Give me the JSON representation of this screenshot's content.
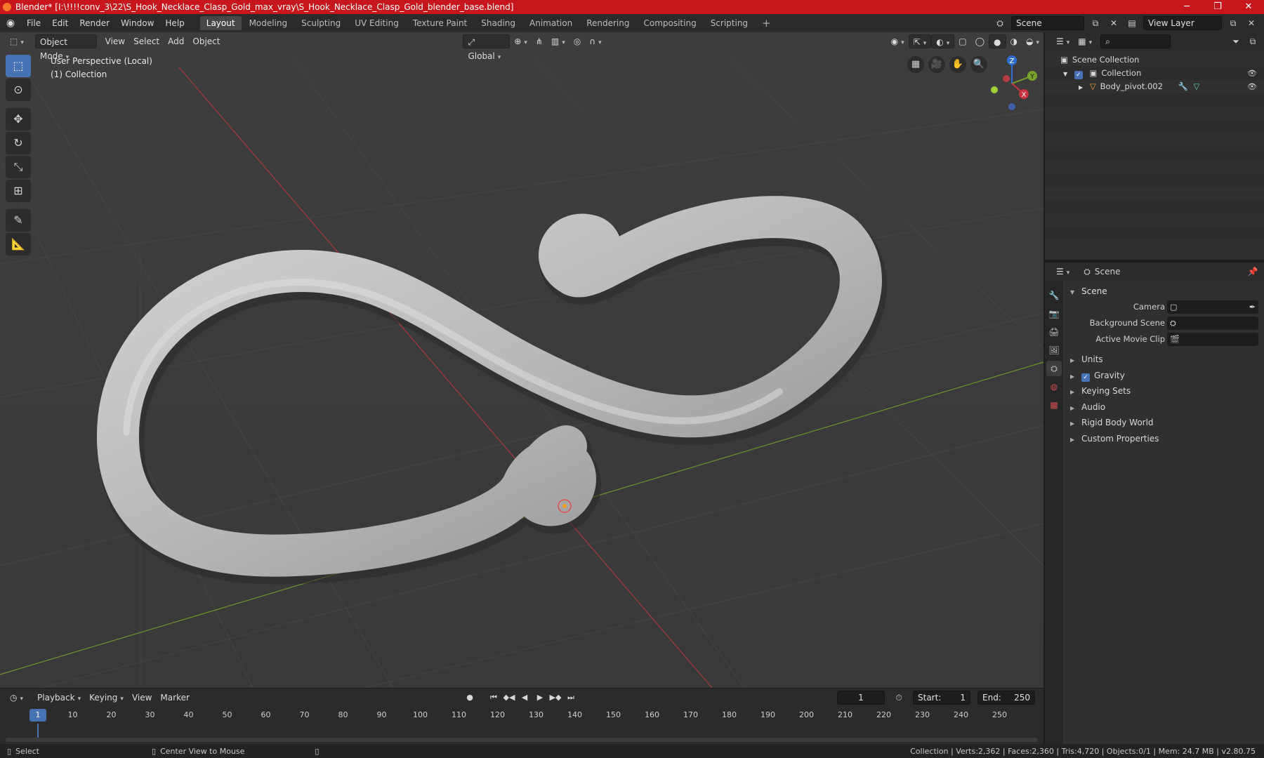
{
  "title_bar": {
    "title": "Blender* [I:\\!!!!conv_3\\22\\S_Hook_Necklace_Clasp_Gold_max_vray\\S_Hook_Necklace_Clasp_Gold_blender_base.blend]",
    "minimize": "─",
    "maximize": "❐",
    "close": "✕"
  },
  "menu": [
    "File",
    "Edit",
    "Render",
    "Window",
    "Help"
  ],
  "workspaces": [
    {
      "label": "Layout",
      "active": true
    },
    {
      "label": "Modeling"
    },
    {
      "label": "Sculpting"
    },
    {
      "label": "UV Editing"
    },
    {
      "label": "Texture Paint"
    },
    {
      "label": "Shading"
    },
    {
      "label": "Animation"
    },
    {
      "label": "Rendering"
    },
    {
      "label": "Compositing"
    },
    {
      "label": "Scripting"
    }
  ],
  "scene_selector": "Scene",
  "view_layer": "View Layer",
  "viewport": {
    "mode": "Object Mode",
    "menus": [
      "View",
      "Select",
      "Add",
      "Object"
    ],
    "transform_orientation": "Global",
    "info_line1": "User Perspective (Local)",
    "info_line2": "(1) Collection",
    "gizmo": {
      "x": "X",
      "y": "Y",
      "z": "Z"
    },
    "colors": {
      "x_axis": "#c9333d",
      "y_axis": "#7aa32b",
      "z_axis": "#2f6dd1",
      "object": "#bebebe"
    }
  },
  "timeline": {
    "menus": [
      "Playback",
      "Keying",
      "View",
      "Marker"
    ],
    "current_frame": "1",
    "start_label": "Start:",
    "start": "1",
    "end_label": "End:",
    "end": "250",
    "ticks": [
      "10",
      "20",
      "30",
      "40",
      "50",
      "60",
      "70",
      "80",
      "90",
      "100",
      "110",
      "120",
      "130",
      "140",
      "150",
      "160",
      "170",
      "180",
      "190",
      "200",
      "210",
      "220",
      "230",
      "240",
      "250"
    ]
  },
  "status_bar": {
    "select": "Select",
    "center_view": "Center View to Mouse",
    "stats": "Collection | Verts:2,362 | Faces:2,360 | Tris:4,720 | Objects:0/1 | Mem: 24.7 MB | v2.80.75"
  },
  "outliner": {
    "search_placeholder": "",
    "scene_collection": "Scene Collection",
    "collection": "Collection",
    "object": "Body_pivot.002"
  },
  "properties": {
    "context": "Scene",
    "panel": "Scene",
    "fields": [
      {
        "label": "Camera",
        "value": ""
      },
      {
        "label": "Background Scene",
        "value": ""
      },
      {
        "label": "Active Movie Clip",
        "value": ""
      }
    ],
    "subpanels": [
      {
        "label": "Units",
        "checkbox": false
      },
      {
        "label": "Gravity",
        "checkbox": true
      },
      {
        "label": "Keying Sets",
        "checkbox": false
      },
      {
        "label": "Audio",
        "checkbox": false
      },
      {
        "label": "Rigid Body World",
        "checkbox": false
      },
      {
        "label": "Custom Properties",
        "checkbox": false
      }
    ]
  }
}
